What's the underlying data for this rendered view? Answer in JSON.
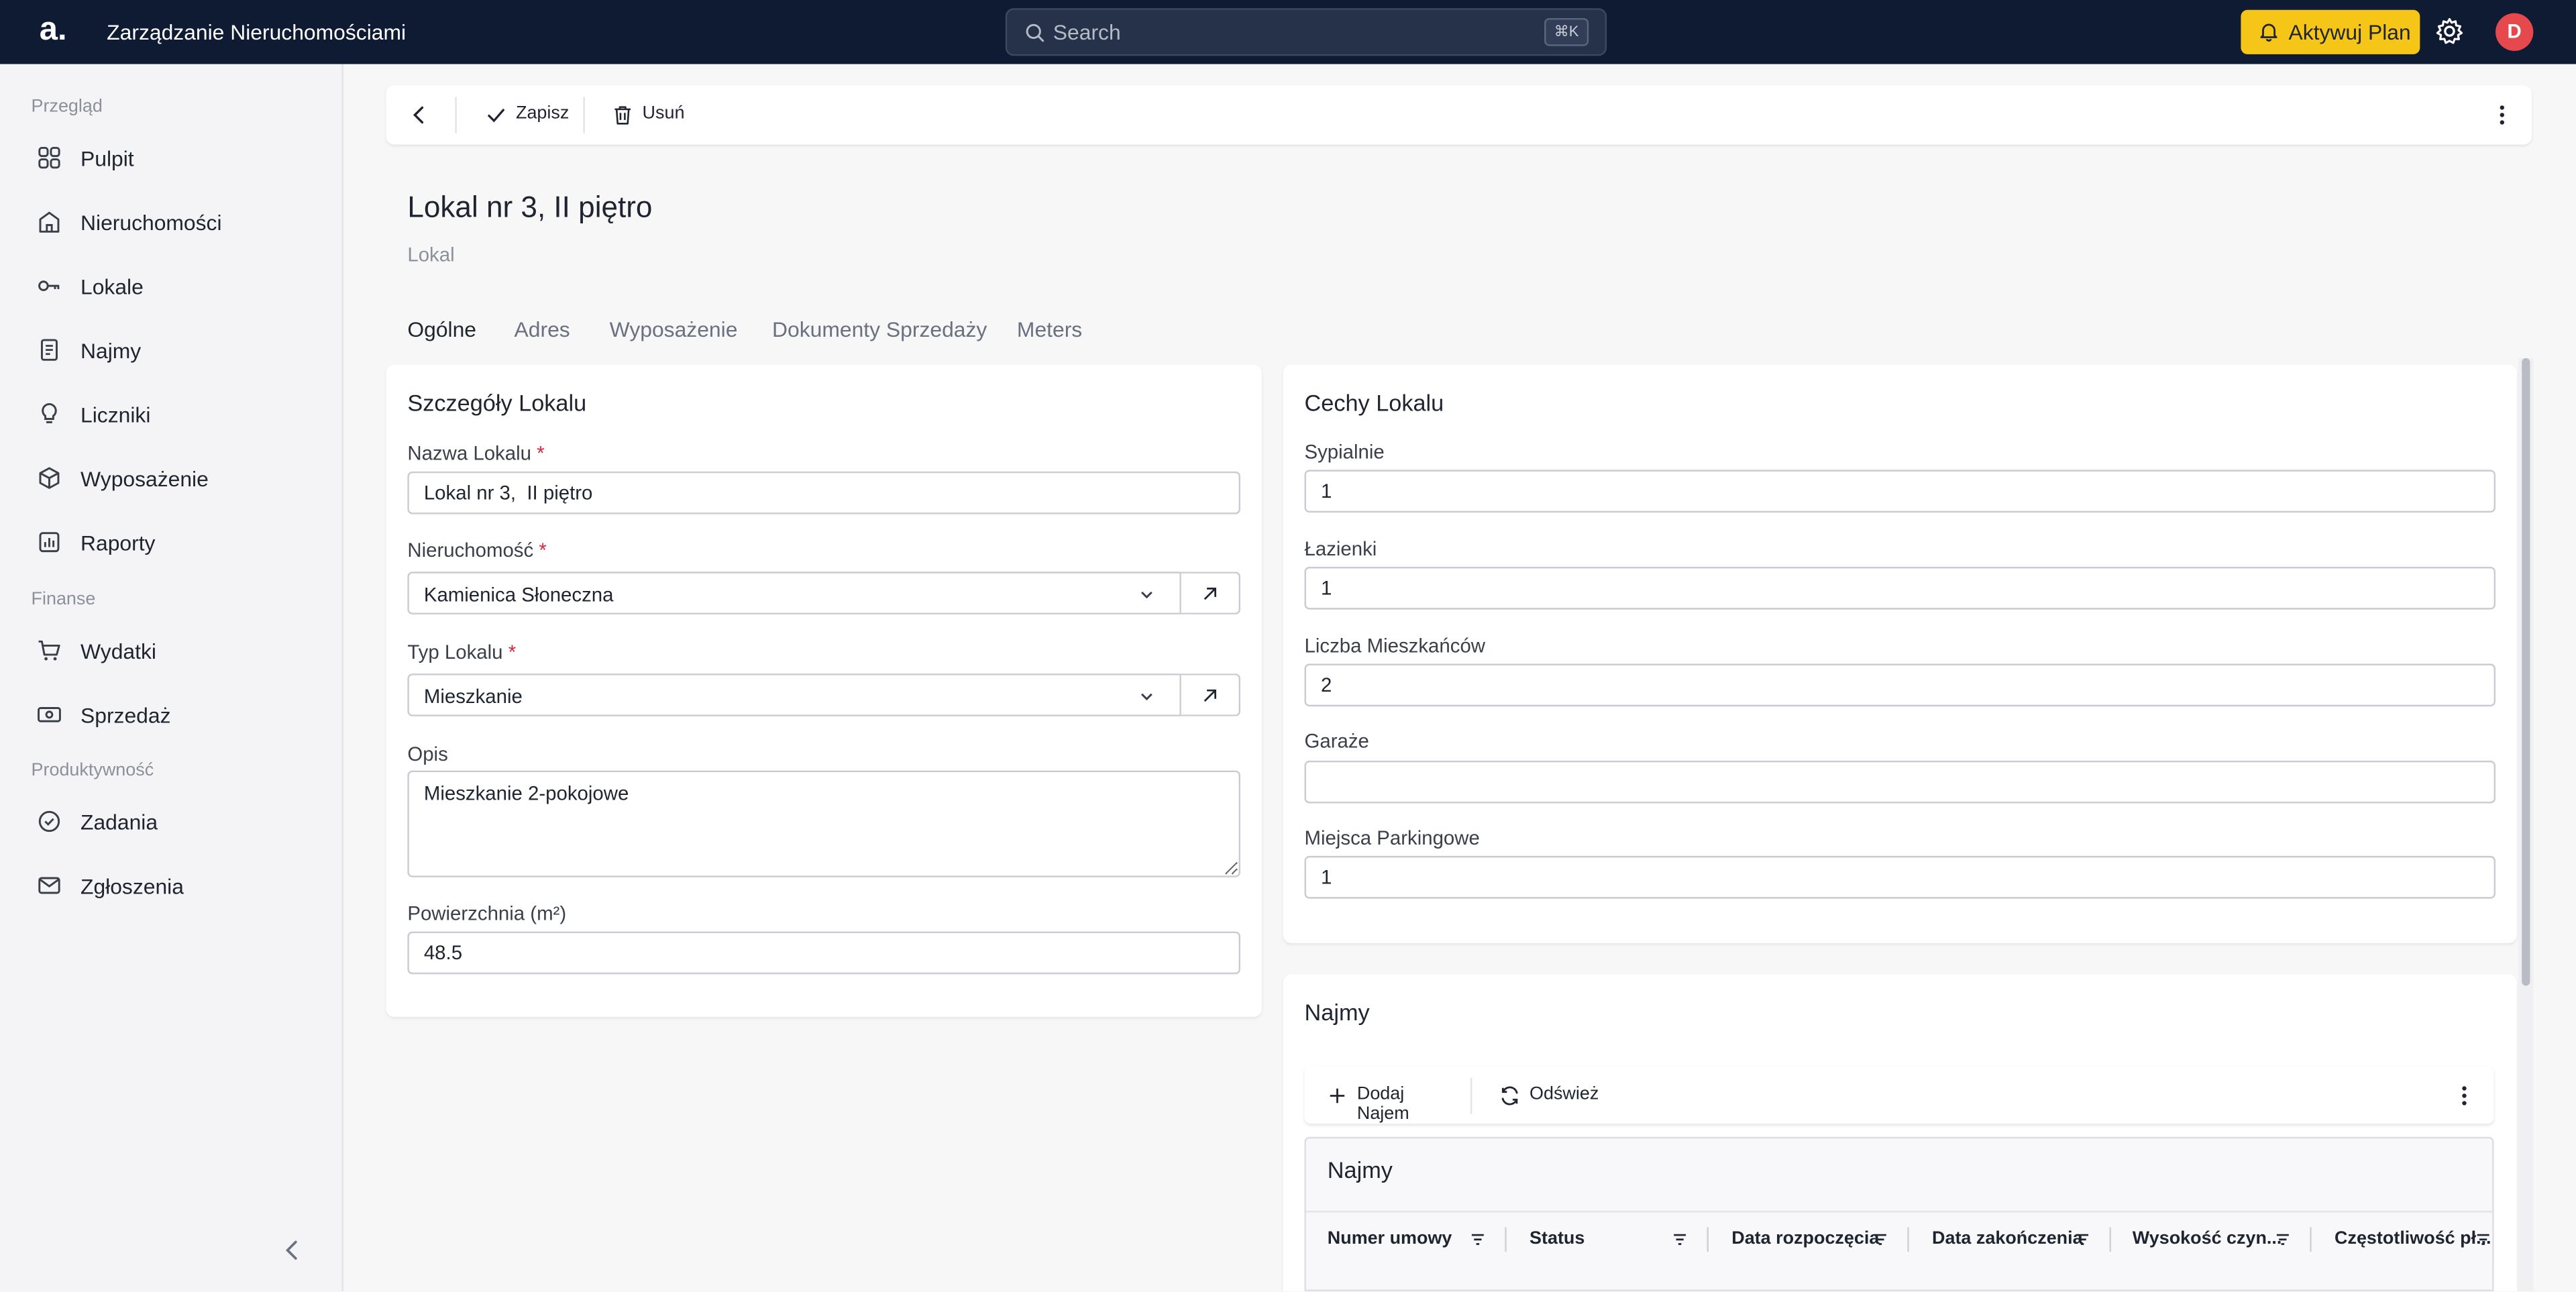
{
  "topbar": {
    "logo": "a.",
    "app_title": "Zarządzanie Nieruchomościami",
    "search_placeholder": "Search",
    "search_shortcut": "⌘K",
    "upgrade_label": "Aktywuj Plan",
    "avatar_initial": "D"
  },
  "sidebar": {
    "sections": {
      "overview": "Przegląd",
      "finance": "Finanse",
      "productivity": "Produktywność"
    },
    "items": [
      {
        "label": "Pulpit",
        "icon": "grid-icon"
      },
      {
        "label": "Nieruchomości",
        "icon": "building-icon"
      },
      {
        "label": "Lokale",
        "icon": "key-icon"
      },
      {
        "label": "Najmy",
        "icon": "document-icon"
      },
      {
        "label": "Liczniki",
        "icon": "bulb-icon"
      },
      {
        "label": "Wyposażenie",
        "icon": "box-icon"
      },
      {
        "label": "Raporty",
        "icon": "chart-icon"
      },
      {
        "label": "Wydatki",
        "icon": "cart-icon"
      },
      {
        "label": "Sprzedaż",
        "icon": "money-icon"
      },
      {
        "label": "Zadania",
        "icon": "check-circle-icon"
      },
      {
        "label": "Zgłoszenia",
        "icon": "mail-icon"
      }
    ]
  },
  "toolbar": {
    "save_label": "Zapisz",
    "delete_label": "Usuń"
  },
  "page": {
    "title": "Lokal nr 3, II piętro",
    "subtitle": "Lokal"
  },
  "tabs": [
    "Ogólne",
    "Adres",
    "Wyposażenie",
    "Dokumenty Sprzedaży",
    "Meters"
  ],
  "details": {
    "title": "Szczegóły Lokalu",
    "name_label": "Nazwa Lokalu",
    "name_value": "Lokal nr 3,  II piętro",
    "property_label": "Nieruchomość",
    "property_value": "Kamienica Słoneczna",
    "type_label": "Typ Lokalu",
    "type_value": "Mieszkanie",
    "description_label": "Opis",
    "description_value": "Mieszkanie 2-pokojowe",
    "area_label": "Powierzchnia (m²)",
    "area_value": "48.5",
    "required_mark": "*"
  },
  "features": {
    "title": "Cechy Lokalu",
    "bedrooms_label": "Sypialnie",
    "bedrooms_value": "1",
    "bathrooms_label": "Łazienki",
    "bathrooms_value": "1",
    "residents_label": "Liczba Mieszkańców",
    "residents_value": "2",
    "garages_label": "Garaże",
    "garages_value": "",
    "parking_label": "Miejsca Parkingowe",
    "parking_value": "1"
  },
  "leases": {
    "title": "Najmy",
    "add_label": "Dodaj Najem",
    "refresh_label": "Odśwież",
    "grid_title": "Najmy",
    "columns": [
      "Numer umowy",
      "Status",
      "Data rozpoczęcia",
      "Data zakończenia",
      "Wysokość czyn...",
      "Częstotliwość pł..."
    ]
  },
  "colors": {
    "topbar_bg": "#0f1b33",
    "accent_yellow": "#f5c518",
    "avatar_red": "#e5484d",
    "required_red": "#d6293e"
  }
}
